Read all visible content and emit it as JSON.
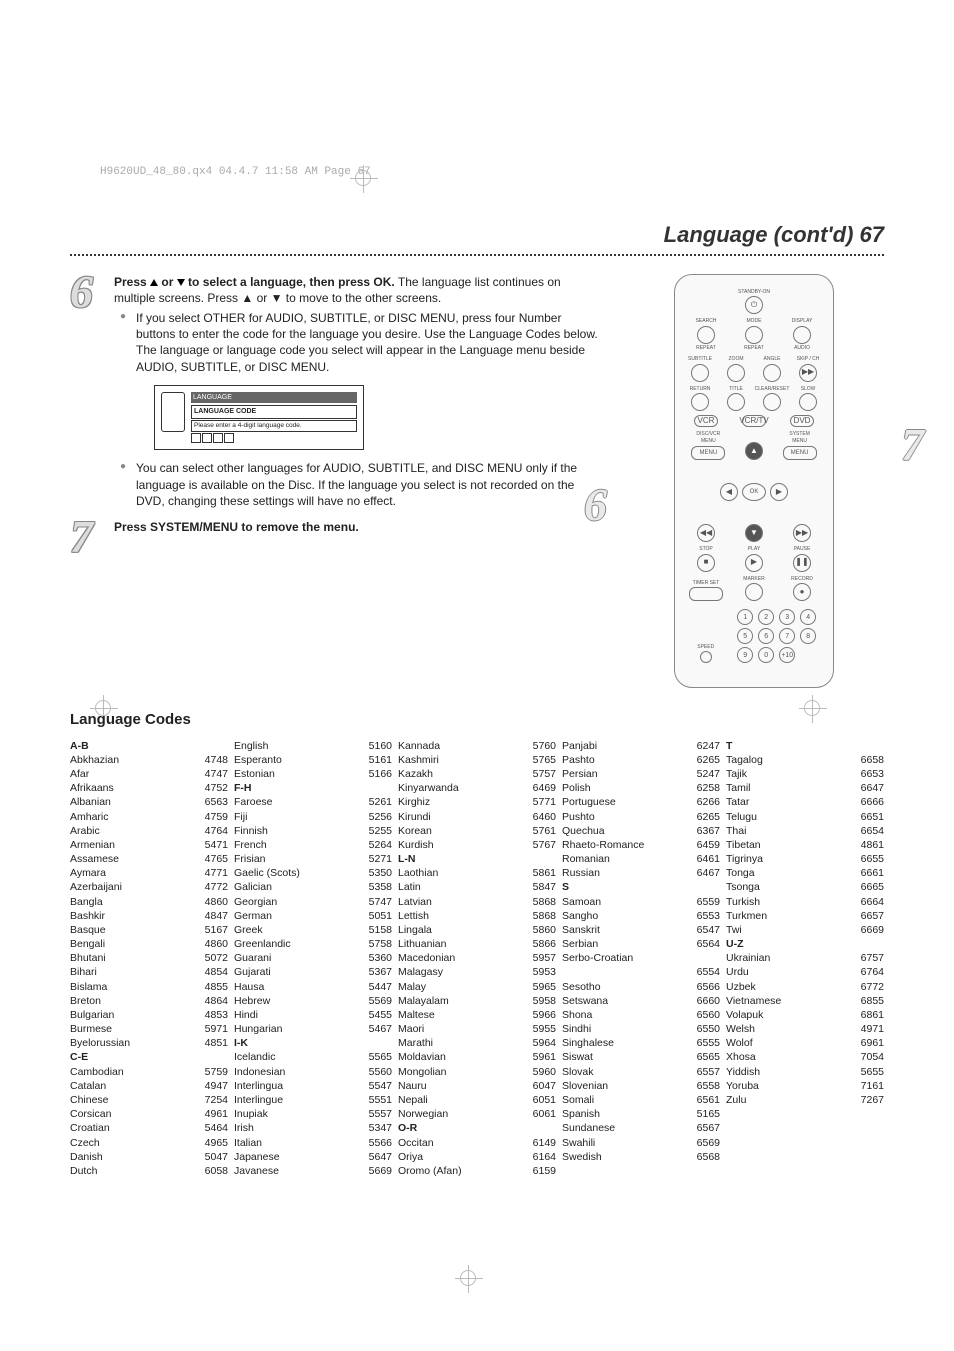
{
  "print_mark": "H9620UD_48_80.qx4  04.4.7  11:58 AM  Page 67",
  "title": "Language (cont'd)  67",
  "step6": {
    "num": "6",
    "p1a": "Press ",
    "p1b": " or ",
    "p1c": " to select a language, then press OK.",
    "p2": "The language list continues on multiple screens. Press ▲ or ▼ to move to the other screens.",
    "bullet1": "If you select OTHER for AUDIO, SUBTITLE, or DISC MENU, press four Number buttons to enter the code for the language you desire. Use the Language Codes below. The language or language code you select will appear in the Language menu beside AUDIO, SUBTITLE, or DISC MENU.",
    "osd_hdr": "LANGUAGE",
    "osd_title": "LANGUAGE CODE",
    "osd_text": "Please enter a 4-digit language code.",
    "bullet2": "You can select other languages for AUDIO, SUBTITLE, and DISC MENU only if the language is available on the Disc. If the language you select is not recorded on the DVD, changing these settings will have no effect."
  },
  "step7": {
    "num": "7",
    "text": "Press SYSTEM/MENU to remove the menu."
  },
  "remote": {
    "standby": "STANDBY-ON",
    "row1": [
      "SEARCH",
      "MODE",
      "DISPLAY"
    ],
    "row1b": [
      "REPEAT",
      "REPEAT",
      "AUDIO"
    ],
    "row2": [
      "SUBTITLE",
      "ZOOM",
      "ANGLE",
      "SKIP / CH"
    ],
    "row3": [
      "RETURN",
      "TITLE",
      "CLEAR/RESET",
      "SLOW"
    ],
    "src": [
      "VCR",
      "VCR/TV",
      "DVD"
    ],
    "menu_l": "DISC/VCR MENU",
    "menu_r": "SYSTEM MENU",
    "ok": "OK",
    "rowp": [
      "STOP",
      "PLAY",
      "PAUSE"
    ],
    "rowt": [
      "TIMER SET",
      "MARKER",
      "RECORD"
    ],
    "speed": "SPEED",
    "nums": [
      "1",
      "2",
      "3",
      "4",
      "5",
      "6",
      "7",
      "8",
      "9",
      "0",
      "+10"
    ]
  },
  "codes_heading": "Language Codes",
  "columns": [
    {
      "rows": [
        {
          "h": "A-B"
        },
        {
          "l": "Abkhazian",
          "c": "4748"
        },
        {
          "l": "Afar",
          "c": "4747"
        },
        {
          "l": "Afrikaans",
          "c": "4752"
        },
        {
          "l": "Albanian",
          "c": "6563"
        },
        {
          "l": "Amharic",
          "c": "4759"
        },
        {
          "l": "Arabic",
          "c": "4764"
        },
        {
          "l": "Armenian",
          "c": "5471"
        },
        {
          "l": "Assamese",
          "c": "4765"
        },
        {
          "l": "Aymara",
          "c": "4771"
        },
        {
          "l": "Azerbaijani",
          "c": "4772"
        },
        {
          "l": "Bangla",
          "c": "4860"
        },
        {
          "l": "Bashkir",
          "c": "4847"
        },
        {
          "l": "Basque",
          "c": "5167"
        },
        {
          "l": "Bengali",
          "c": "4860"
        },
        {
          "l": "Bhutani",
          "c": "5072"
        },
        {
          "l": "Bihari",
          "c": "4854"
        },
        {
          "l": "Bislama",
          "c": "4855"
        },
        {
          "l": "Breton",
          "c": "4864"
        },
        {
          "l": "Bulgarian",
          "c": "4853"
        },
        {
          "l": "Burmese",
          "c": "5971"
        },
        {
          "l": "Byelorussian",
          "c": "4851"
        },
        {
          "h": "C-E"
        },
        {
          "l": "Cambodian",
          "c": "5759"
        },
        {
          "l": "Catalan",
          "c": "4947"
        },
        {
          "l": "Chinese",
          "c": "7254"
        },
        {
          "l": "Corsican",
          "c": "4961"
        },
        {
          "l": "Croatian",
          "c": "5464"
        },
        {
          "l": "Czech",
          "c": "4965"
        },
        {
          "l": "Danish",
          "c": "5047"
        },
        {
          "l": "Dutch",
          "c": "6058"
        }
      ]
    },
    {
      "rows": [
        {
          "l": "English",
          "c": "5160"
        },
        {
          "l": "Esperanto",
          "c": "5161"
        },
        {
          "l": "Estonian",
          "c": "5166"
        },
        {
          "h": "F-H"
        },
        {
          "l": "Faroese",
          "c": "5261"
        },
        {
          "l": "Fiji",
          "c": "5256"
        },
        {
          "l": "Finnish",
          "c": "5255"
        },
        {
          "l": "French",
          "c": "5264"
        },
        {
          "l": "Frisian",
          "c": "5271"
        },
        {
          "l": "Gaelic (Scots)",
          "c": "5350"
        },
        {
          "l": "Galician",
          "c": "5358"
        },
        {
          "l": "Georgian",
          "c": "5747"
        },
        {
          "l": "German",
          "c": "5051"
        },
        {
          "l": "Greek",
          "c": "5158"
        },
        {
          "l": "Greenlandic",
          "c": "5758"
        },
        {
          "l": "Guarani",
          "c": "5360"
        },
        {
          "l": "Gujarati",
          "c": "5367"
        },
        {
          "l": "Hausa",
          "c": "5447"
        },
        {
          "l": "Hebrew",
          "c": "5569"
        },
        {
          "l": "Hindi",
          "c": "5455"
        },
        {
          "l": "Hungarian",
          "c": "5467"
        },
        {
          "h": "I-K"
        },
        {
          "l": "Icelandic",
          "c": "5565"
        },
        {
          "l": "Indonesian",
          "c": "5560"
        },
        {
          "l": "Interlingua",
          "c": "5547"
        },
        {
          "l": "Interlingue",
          "c": "5551"
        },
        {
          "l": "Inupiak",
          "c": "5557"
        },
        {
          "l": "Irish",
          "c": "5347"
        },
        {
          "l": "Italian",
          "c": "5566"
        },
        {
          "l": "Japanese",
          "c": "5647"
        },
        {
          "l": "Javanese",
          "c": "5669"
        }
      ]
    },
    {
      "rows": [
        {
          "l": "Kannada",
          "c": "5760"
        },
        {
          "l": "Kashmiri",
          "c": "5765"
        },
        {
          "l": "Kazakh",
          "c": "5757"
        },
        {
          "l": "Kinyarwanda",
          "c": "6469"
        },
        {
          "l": "Kirghiz",
          "c": "5771"
        },
        {
          "l": "Kirundi",
          "c": "6460"
        },
        {
          "l": "Korean",
          "c": "5761"
        },
        {
          "l": "Kurdish",
          "c": "5767"
        },
        {
          "h": "L-N"
        },
        {
          "l": "Laothian",
          "c": "5861"
        },
        {
          "l": "Latin",
          "c": "5847"
        },
        {
          "l": "Latvian",
          "c": "5868"
        },
        {
          "l": "Lettish",
          "c": "5868"
        },
        {
          "l": "Lingala",
          "c": "5860"
        },
        {
          "l": "Lithuanian",
          "c": "5866"
        },
        {
          "l": "Macedonian",
          "c": "5957"
        },
        {
          "l": "Malagasy",
          "c": "5953"
        },
        {
          "l": "Malay",
          "c": "5965"
        },
        {
          "l": "Malayalam",
          "c": "5958"
        },
        {
          "l": "Maltese",
          "c": "5966"
        },
        {
          "l": "Maori",
          "c": "5955"
        },
        {
          "l": "Marathi",
          "c": "5964"
        },
        {
          "l": "Moldavian",
          "c": "5961"
        },
        {
          "l": "Mongolian",
          "c": "5960"
        },
        {
          "l": "Nauru",
          "c": "6047"
        },
        {
          "l": "Nepali",
          "c": "6051"
        },
        {
          "l": "Norwegian",
          "c": "6061"
        },
        {
          "h": "O-R"
        },
        {
          "l": "Occitan",
          "c": "6149"
        },
        {
          "l": "Oriya",
          "c": "6164"
        },
        {
          "l": "Oromo (Afan)",
          "c": "6159"
        }
      ]
    },
    {
      "rows": [
        {
          "l": "Panjabi",
          "c": "6247"
        },
        {
          "l": "Pashto",
          "c": "6265"
        },
        {
          "l": "Persian",
          "c": "5247"
        },
        {
          "l": "Polish",
          "c": "6258"
        },
        {
          "l": "Portuguese",
          "c": "6266"
        },
        {
          "l": "Pushto",
          "c": "6265"
        },
        {
          "l": "Quechua",
          "c": "6367"
        },
        {
          "l": "Rhaeto-Romance",
          "c": "6459"
        },
        {
          "l": "Romanian",
          "c": "6461"
        },
        {
          "l": "Russian",
          "c": "6467"
        },
        {
          "h": "S"
        },
        {
          "l": "Samoan",
          "c": "6559"
        },
        {
          "l": "Sangho",
          "c": "6553"
        },
        {
          "l": "Sanskrit",
          "c": "6547"
        },
        {
          "l": "Serbian",
          "c": "6564"
        },
        {
          "l": "Serbo-Croatian",
          "c": ""
        },
        {
          "l": "",
          "c": "6554"
        },
        {
          "l": "Sesotho",
          "c": "6566"
        },
        {
          "l": "Setswana",
          "c": "6660"
        },
        {
          "l": "Shona",
          "c": "6560"
        },
        {
          "l": "Sindhi",
          "c": "6550"
        },
        {
          "l": "Singhalese",
          "c": "6555"
        },
        {
          "l": "Siswat",
          "c": "6565"
        },
        {
          "l": "Slovak",
          "c": "6557"
        },
        {
          "l": "Slovenian",
          "c": "6558"
        },
        {
          "l": "Somali",
          "c": "6561"
        },
        {
          "l": "Spanish",
          "c": "5165"
        },
        {
          "l": "Sundanese",
          "c": "6567"
        },
        {
          "l": "Swahili",
          "c": "6569"
        },
        {
          "l": "Swedish",
          "c": "6568"
        }
      ]
    },
    {
      "rows": [
        {
          "h": "T"
        },
        {
          "l": "Tagalog",
          "c": "6658"
        },
        {
          "l": "Tajik",
          "c": "6653"
        },
        {
          "l": "Tamil",
          "c": "6647"
        },
        {
          "l": "Tatar",
          "c": "6666"
        },
        {
          "l": "Telugu",
          "c": "6651"
        },
        {
          "l": "Thai",
          "c": "6654"
        },
        {
          "l": "Tibetan",
          "c": "4861"
        },
        {
          "l": "Tigrinya",
          "c": "6655"
        },
        {
          "l": "Tonga",
          "c": "6661"
        },
        {
          "l": "Tsonga",
          "c": "6665"
        },
        {
          "l": "Turkish",
          "c": "6664"
        },
        {
          "l": "Turkmen",
          "c": "6657"
        },
        {
          "l": "Twi",
          "c": "6669"
        },
        {
          "h": "U-Z"
        },
        {
          "l": "Ukrainian",
          "c": "6757"
        },
        {
          "l": "Urdu",
          "c": "6764"
        },
        {
          "l": "Uzbek",
          "c": "6772"
        },
        {
          "l": "Vietnamese",
          "c": "6855"
        },
        {
          "l": "Volapuk",
          "c": "6861"
        },
        {
          "l": "Welsh",
          "c": "4971"
        },
        {
          "l": "Wolof",
          "c": "6961"
        },
        {
          "l": "Xhosa",
          "c": "7054"
        },
        {
          "l": "Yiddish",
          "c": "5655"
        },
        {
          "l": "Yoruba",
          "c": "7161"
        },
        {
          "l": "Zulu",
          "c": "7267"
        }
      ]
    }
  ]
}
